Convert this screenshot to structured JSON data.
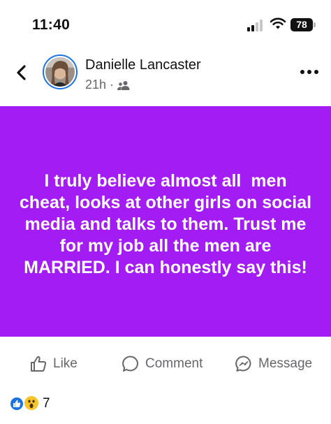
{
  "status_bar": {
    "time": "11:40",
    "battery": "78",
    "icons": [
      "cellular-signal-icon",
      "wifi-icon",
      "battery-icon"
    ]
  },
  "header": {
    "author_name": "Danielle Lancaster",
    "timestamp": "21h",
    "separator": "·",
    "audience_icon": "friends-icon",
    "back_icon": "chevron-left-icon",
    "more_icon": "more-horizontal-icon"
  },
  "post": {
    "background_color": "#a31cf4",
    "text_color": "#ffffff",
    "text": "I truly believe almost all  men cheat, looks at other girls on social media and talks to them. Trust me for my job all the men are MARRIED. I can honestly say this!"
  },
  "actions": {
    "like_label": "Like",
    "comment_label": "Comment",
    "message_label": "Message"
  },
  "reactions": {
    "types": [
      "like",
      "wow"
    ],
    "count": "7"
  },
  "colors": {
    "brand_blue": "#1b74e4",
    "secondary_text": "#65676b"
  }
}
